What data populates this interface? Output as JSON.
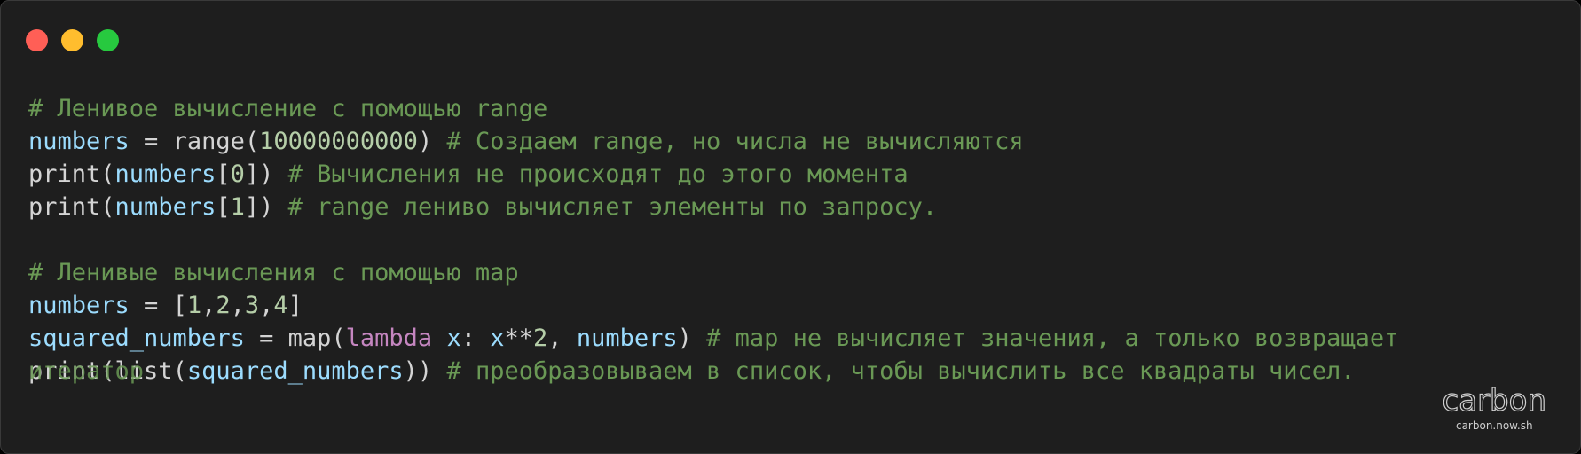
{
  "window": {
    "controls": [
      "close",
      "minimize",
      "maximize"
    ],
    "colors": {
      "close": "#ff5f56",
      "minimize": "#ffbd2e",
      "maximize": "#27c93f",
      "background": "#1e1e1e"
    }
  },
  "code": {
    "lines": [
      [
        {
          "t": "# Ленивое вычисление с помощью range",
          "c": "comment"
        }
      ],
      [
        {
          "t": "numbers",
          "c": "var"
        },
        {
          "t": " = ",
          "c": "op"
        },
        {
          "t": "range(",
          "c": "fn"
        },
        {
          "t": "10000000000",
          "c": "num"
        },
        {
          "t": ") ",
          "c": "fn"
        },
        {
          "t": "# Создаем range, но числа не вычисляются",
          "c": "comment"
        }
      ],
      [
        {
          "t": "print(",
          "c": "fn"
        },
        {
          "t": "numbers",
          "c": "var"
        },
        {
          "t": "[",
          "c": "fn"
        },
        {
          "t": "0",
          "c": "num"
        },
        {
          "t": "]) ",
          "c": "fn"
        },
        {
          "t": "# Вычисления не происходят до этого момента",
          "c": "comment"
        }
      ],
      [
        {
          "t": "print(",
          "c": "fn"
        },
        {
          "t": "numbers",
          "c": "var"
        },
        {
          "t": "[",
          "c": "fn"
        },
        {
          "t": "1",
          "c": "num"
        },
        {
          "t": "]) ",
          "c": "fn"
        },
        {
          "t": "# range лениво вычисляет элементы по запросу.",
          "c": "comment"
        }
      ],
      [],
      [
        {
          "t": "# Ленивые вычисления с помощью map",
          "c": "comment"
        }
      ],
      [
        {
          "t": "numbers",
          "c": "var"
        },
        {
          "t": " = [",
          "c": "op"
        },
        {
          "t": "1",
          "c": "num"
        },
        {
          "t": ",",
          "c": "op"
        },
        {
          "t": "2",
          "c": "num"
        },
        {
          "t": ",",
          "c": "op"
        },
        {
          "t": "3",
          "c": "num"
        },
        {
          "t": ",",
          "c": "op"
        },
        {
          "t": "4",
          "c": "num"
        },
        {
          "t": "]",
          "c": "op"
        }
      ],
      [
        {
          "t": "squared_numbers",
          "c": "var"
        },
        {
          "t": " = ",
          "c": "op"
        },
        {
          "t": "map(",
          "c": "fn"
        },
        {
          "t": "lambda",
          "c": "kw"
        },
        {
          "t": " ",
          "c": "op"
        },
        {
          "t": "x",
          "c": "var"
        },
        {
          "t": ": ",
          "c": "op"
        },
        {
          "t": "x",
          "c": "var"
        },
        {
          "t": "**",
          "c": "op"
        },
        {
          "t": "2",
          "c": "num"
        },
        {
          "t": ", ",
          "c": "op"
        },
        {
          "t": "numbers",
          "c": "var"
        },
        {
          "t": ") ",
          "c": "fn"
        },
        {
          "t": "# map не вычисляет значения, а только возвращает",
          "c": "comment"
        }
      ],
      [
        {
          "t": "print(",
          "c": "fn"
        },
        {
          "t": "list(",
          "c": "fn"
        },
        {
          "t": "squared_numbers",
          "c": "var"
        },
        {
          "t": ")) ",
          "c": "fn"
        },
        {
          "t": "# преобразовываем в список, чтобы вычислить все квадраты чисел.",
          "c": "comment"
        }
      ]
    ],
    "overlap_text": "итератор"
  },
  "watermark": {
    "logo": "carbon",
    "url": "carbon.now.sh"
  }
}
